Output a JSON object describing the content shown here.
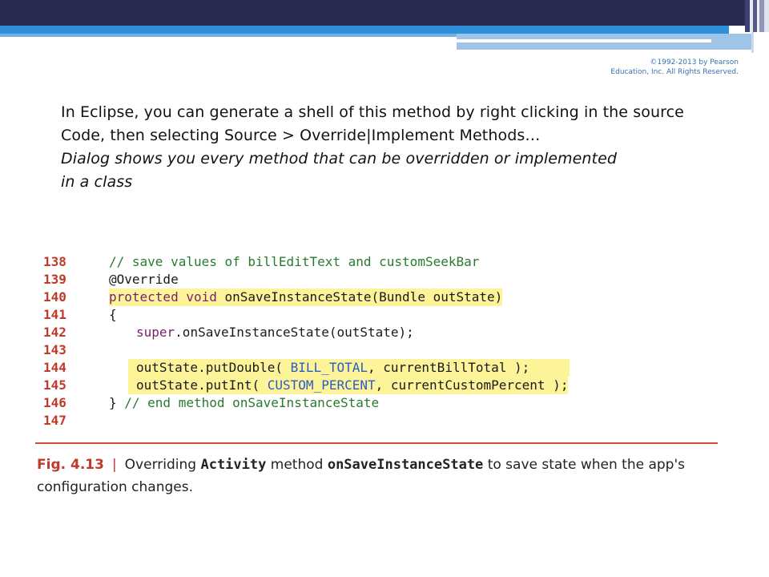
{
  "copyright": "©1992-2013 by Pearson Education, Inc. All Rights Reserved.",
  "body": {
    "line1": "In Eclipse, you can generate a shell of this method by right clicking in the source",
    "line2": "Code, then selecting Source > Override|Implement Methods…",
    "line3": "Dialog shows you every method that can be overridden or implemented",
    "line4": "in a class"
  },
  "code": {
    "line_numbers": [
      "138",
      "139",
      "140",
      "141",
      "142",
      "143",
      "144",
      "145",
      "146",
      "147"
    ],
    "l138": "// save values of billEditText and customSeekBar",
    "l139": "@Override",
    "l140_kw": "protected void",
    "l140_rest": " onSaveInstanceState(Bundle outState)",
    "l141": "{",
    "l142_kw": "super",
    "l142_rest": ".onSaveInstanceState(outState);",
    "l143": "",
    "l144_a": "outState.putDouble( ",
    "l144_const": "BILL_TOTAL",
    "l144_b": ", currentBillTotal );",
    "l145_a": "outState.putInt( ",
    "l145_const": "CUSTOM_PERCENT",
    "l145_b": ", currentCustomPercent );",
    "l146_a": "} ",
    "l146_comment": "// end method onSaveInstanceState",
    "l147": ""
  },
  "caption": {
    "label": "Fig. 4.13",
    "separator": "|",
    "text1": "Overriding ",
    "mono1": "Activity",
    "text2": " method ",
    "mono2": "onSaveInstanceState",
    "text3": " to save state when the app's configuration changes."
  },
  "colors": {
    "header_dark": "#262b4f",
    "header_blue": "#2f8fd9",
    "line_number_red": "#c0392b",
    "highlight_yellow": "#fdf49a"
  }
}
